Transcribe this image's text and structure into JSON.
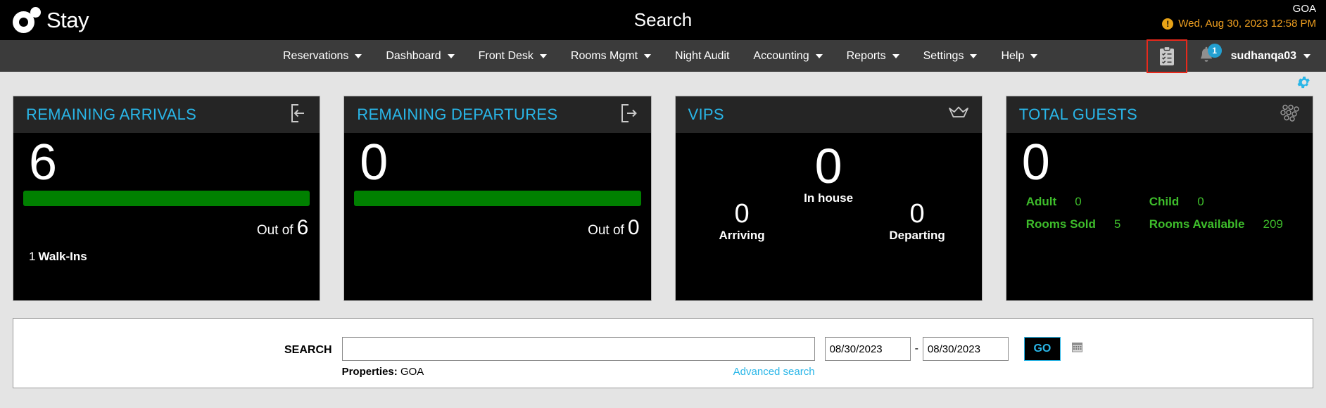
{
  "brand": {
    "name": "Stay",
    "logo_icon": "e-stay-logo-icon"
  },
  "header": {
    "title": "Search",
    "property_code": "GOA",
    "warning_icon": "alert-exclamation-icon",
    "business_date": "Wed, Aug 30, 2023 12:58 PM"
  },
  "nav": {
    "items": [
      {
        "label": "Reservations",
        "has_caret": true
      },
      {
        "label": "Dashboard",
        "has_caret": true
      },
      {
        "label": "Front Desk",
        "has_caret": true
      },
      {
        "label": "Rooms Mgmt",
        "has_caret": true
      },
      {
        "label": "Night Audit",
        "has_caret": false
      },
      {
        "label": "Accounting",
        "has_caret": true
      },
      {
        "label": "Reports",
        "has_caret": true
      },
      {
        "label": "Settings",
        "has_caret": true
      },
      {
        "label": "Help",
        "has_caret": true
      }
    ],
    "tasks_icon": "clipboard-tasks-icon",
    "notifications_icon": "bell-icon",
    "notifications_count": "1",
    "user": "sudhanqa03",
    "settings_icon": "gear-icon"
  },
  "cards": [
    {
      "title": "REMAINING ARRIVALS",
      "icon": "arrival-door-in-icon",
      "value": "6",
      "out_of_label": "Out of",
      "out_of_value": "6",
      "walkins_count": "1",
      "walkins_label": "Walk-Ins",
      "bar_color": "#008000"
    },
    {
      "title": "REMAINING DEPARTURES",
      "icon": "departure-door-out-icon",
      "value": "0",
      "out_of_label": "Out of",
      "out_of_value": "0",
      "bar_color": "#008000"
    },
    {
      "title": "VIPS",
      "icon": "crown-icon",
      "in_house_value": "0",
      "in_house_label": "In house",
      "arriving_value": "0",
      "arriving_label": "Arriving",
      "departing_value": "0",
      "departing_label": "Departing"
    },
    {
      "title": "TOTAL GUESTS",
      "icon": "guests-group-icon",
      "value": "0",
      "adult_label": "Adult",
      "adult_value": "0",
      "child_label": "Child",
      "child_value": "0",
      "rooms_sold_label": "Rooms Sold",
      "rooms_sold_value": "5",
      "rooms_available_label": "Rooms Available",
      "rooms_available_value": "209",
      "stat_color": "#3ebd2b"
    }
  ],
  "search": {
    "label": "SEARCH",
    "value": "",
    "placeholder": "",
    "properties_label": "Properties:",
    "properties_value": "GOA",
    "advanced_link": "Advanced search",
    "date_from": "08/30/2023",
    "date_to": "08/30/2023",
    "date_separator": "-",
    "calendar_icon": "calendar-icon",
    "go_label": "GO"
  },
  "colors": {
    "accent_cyan": "#29b6e8",
    "green": "#008000",
    "stat_green": "#3ebd2b",
    "orange": "#f0a020",
    "highlight_red": "#e8291c"
  }
}
